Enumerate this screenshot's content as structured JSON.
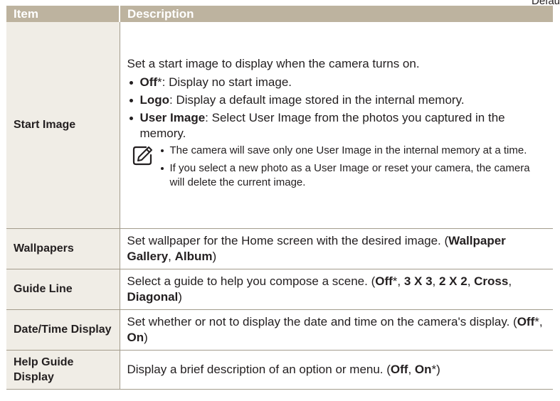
{
  "corner_text": "Default",
  "header": {
    "item": "Item",
    "description": "Description"
  },
  "rows": [
    {
      "item": "Start Image",
      "intro": "Set a start image to display when the camera turns on.",
      "bullets": [
        {
          "b": "Off",
          "t": "*: Display no start image."
        },
        {
          "b": "Logo",
          "t": ": Display a default image stored in the internal memory."
        },
        {
          "b": "User Image",
          "t": ": Select User Image from the photos you captured in the memory."
        }
      ],
      "notes": [
        "The camera will save only one User Image in the internal memory at a time.",
        "If you select a new photo as a User Image or reset your camera, the camera will delete the current image."
      ]
    },
    {
      "item": "Wallpapers",
      "text": "Set wallpaper for the Home screen with the desired image.",
      "opts": [
        "Wallpaper Gallery",
        "Album"
      ]
    },
    {
      "item": "Guide Line",
      "text": "Select a guide to help you compose a scene.",
      "opts": [
        "Off",
        "3 X 3",
        "2 X 2",
        "Cross",
        "Diagonal"
      ]
    },
    {
      "item": "Date/Time Display",
      "text": "Set whether or not to display the date and time on the camera's display.",
      "opts": [
        "Off",
        "On"
      ]
    },
    {
      "item": "Help Guide Display",
      "text": "Display a brief description of an option or menu.",
      "opts": [
        "Off",
        "On"
      ]
    }
  ]
}
